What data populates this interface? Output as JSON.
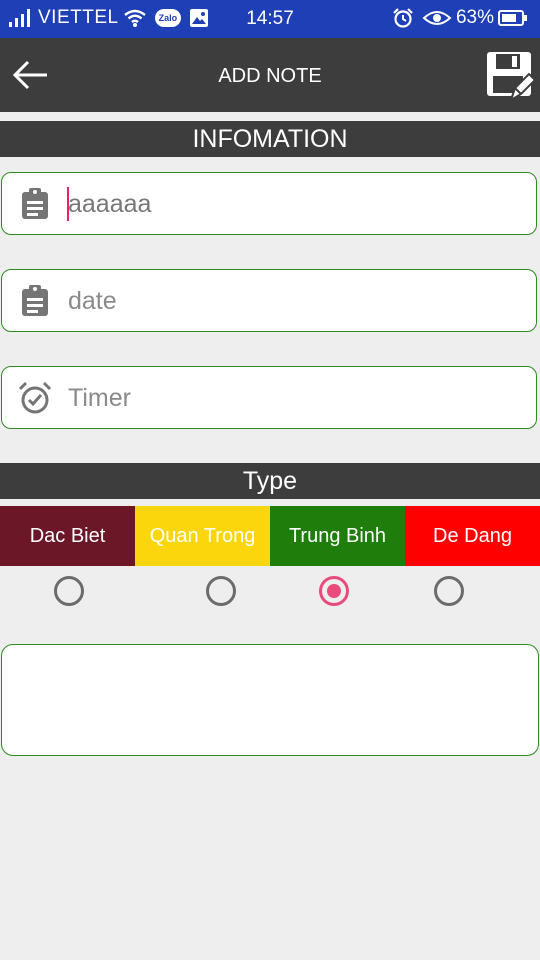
{
  "status_bar": {
    "carrier": "VIETTEL",
    "zalo_label": "Zalo",
    "time": "14:57",
    "battery": "63%"
  },
  "toolbar": {
    "title": "ADD NOTE"
  },
  "info_section": {
    "title": "INFOMATION",
    "fields": [
      {
        "value": "aaaaaa",
        "placeholder": "",
        "icon": "clipboard-icon"
      },
      {
        "value": "",
        "placeholder": "date",
        "icon": "clipboard-icon"
      },
      {
        "value": "",
        "placeholder": "Timer",
        "icon": "alarm-clock-icon"
      }
    ]
  },
  "type_section": {
    "title": "Type",
    "options": [
      {
        "label": "Dac Biet",
        "color": "#6b1727",
        "text_color": "#ffffff",
        "selected": false
      },
      {
        "label": "Quan Trong",
        "color": "#fbd60d",
        "text_color": "#ffffff",
        "selected": false
      },
      {
        "label": "Trung Binh",
        "color": "#1e7d0b",
        "text_color": "#ffffff",
        "selected": true
      },
      {
        "label": "De Dang",
        "color": "#ff0000",
        "text_color": "#ffffff",
        "selected": false
      }
    ]
  },
  "note": {
    "value": ""
  },
  "colors": {
    "status_bar": "#1e3fb5",
    "toolbar": "#3d3d3d",
    "field_border": "#2e8b1f",
    "radio_accent": "#e94b7b"
  }
}
